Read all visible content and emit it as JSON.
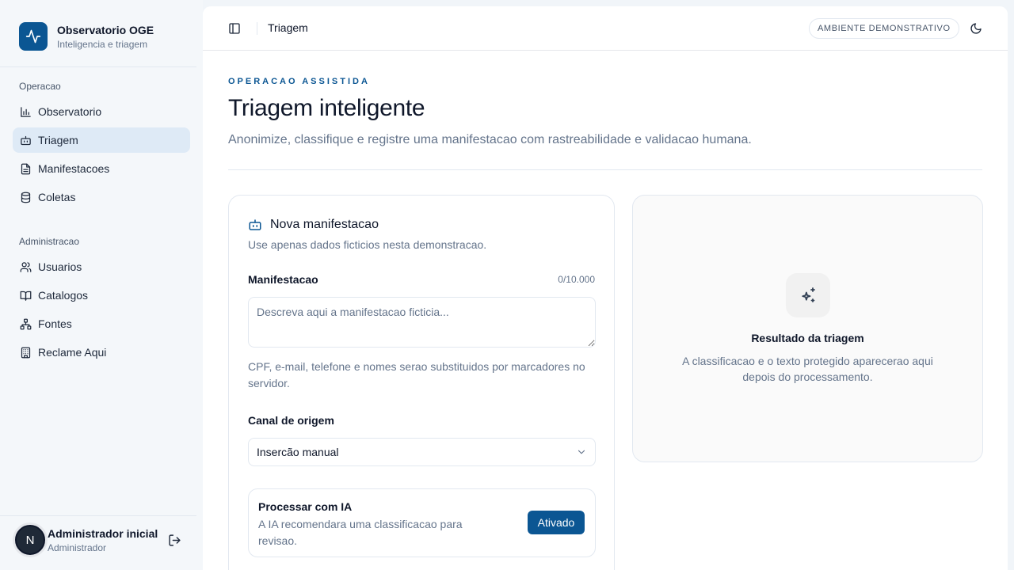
{
  "brand": {
    "title": "Observatorio OGE",
    "subtitle": "Inteligencia e triagem",
    "icon": "activity-icon",
    "color": "#0b5693"
  },
  "sidebar": {
    "sections": [
      {
        "label": "Operacao",
        "items": [
          {
            "label": "Observatorio",
            "icon": "bar-chart-icon",
            "active": false
          },
          {
            "label": "Triagem",
            "icon": "bot-icon",
            "active": true
          },
          {
            "label": "Manifestacoes",
            "icon": "file-text-icon",
            "active": false
          },
          {
            "label": "Coletas",
            "icon": "database-icon",
            "active": false
          }
        ]
      },
      {
        "label": "Administracao",
        "items": [
          {
            "label": "Usuarios",
            "icon": "users-icon",
            "active": false
          },
          {
            "label": "Catalogos",
            "icon": "book-open-icon",
            "active": false
          },
          {
            "label": "Fontes",
            "icon": "network-icon",
            "active": false
          },
          {
            "label": "Reclame Aqui",
            "icon": "building-icon",
            "active": false
          }
        ]
      }
    ]
  },
  "user": {
    "initial": "N",
    "name": "Administrador inicial",
    "role": "Administrador"
  },
  "topbar": {
    "title": "Triagem",
    "environment_badge": "AMBIENTE DEMONSTRATIVO"
  },
  "page": {
    "eyebrow": "OPERACAO ASSISTIDA",
    "title": "Triagem inteligente",
    "description": "Anonimize, classifique e registre uma manifestacao com rastreabilidade e validacao humana."
  },
  "form": {
    "title": "Nova manifestacao",
    "subtitle": "Use apenas dados ficticios nesta demonstracao.",
    "manifestacao_label": "Manifestacao",
    "counter": "0/10.000",
    "placeholder": "Descreva aqui a manifestacao ficticia...",
    "value": "",
    "hint": "CPF, e-mail, telefone e nomes serao substituidos por marcadores no servidor.",
    "canal_label": "Canal de origem",
    "canal_selected": "Insercão manual",
    "ia_title": "Processar com IA",
    "ia_description": "A IA recomendara uma classificacao para revisao.",
    "ia_button": "Ativado"
  },
  "result": {
    "title": "Resultado da triagem",
    "description": "A classificacao e o texto protegido aparecerao aqui depois do processamento.",
    "icon": "sparkles-icon"
  }
}
